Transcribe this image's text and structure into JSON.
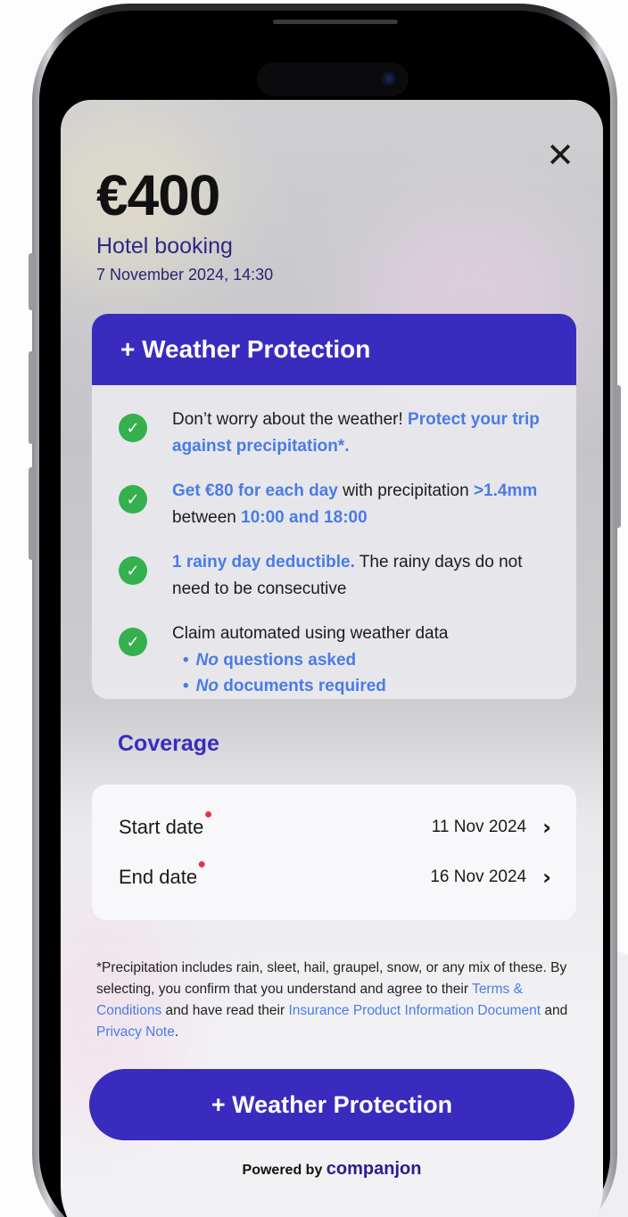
{
  "header": {
    "close_icon": "close-icon",
    "amount": "€400",
    "merchant": "Hotel booking",
    "datetime": "7 November 2024, 14:30"
  },
  "offer": {
    "title": "+ Weather Protection",
    "benefits": [
      {
        "icon": "check-circle-icon",
        "plain_1": "Don’t worry about the weather! ",
        "highlight_1": "Protect your trip against precipitation*."
      },
      {
        "icon": "check-circle-icon",
        "highlight_1": "Get €80 for each day",
        "plain_1": " with precipitation ",
        "highlight_2": ">1.4mm",
        "plain_2": " between ",
        "highlight_3": "10:00 and 18:00"
      },
      {
        "icon": "check-circle-icon",
        "highlight_1": "1 rainy day deductible.",
        "plain_1": " The rainy days do not need to be consecutive"
      },
      {
        "icon": "check-circle-icon",
        "plain_1": "Claim automated using weather data",
        "sub_items": [
          {
            "em": "No",
            "rest": " questions asked"
          },
          {
            "em": "No",
            "rest": " documents required"
          }
        ]
      }
    ]
  },
  "coverage": {
    "title": "Coverage",
    "start": {
      "label": "Start date",
      "value": "11 Nov 2024"
    },
    "end": {
      "label": "End date",
      "value": "16 Nov 2024"
    }
  },
  "legal": {
    "text_1": "*Precipitation includes rain, sleet, hail, graupel, snow, or any mix of these. By selecting, you confirm that you understand and agree to their ",
    "link_terms": "Terms & Conditions",
    "text_2": " and have read their ",
    "link_ipid": "Insurance Product Information Document",
    "text_3": " and ",
    "link_privacy": "Privacy Note",
    "text_4": "."
  },
  "cta": {
    "label": "+ Weather Protection"
  },
  "footer": {
    "powered_by": "Powered by",
    "brand": "companjon"
  },
  "colors": {
    "primary": "#3a2bbf",
    "link": "#4a7be6",
    "success": "#34b04f",
    "required": "#e53346"
  }
}
